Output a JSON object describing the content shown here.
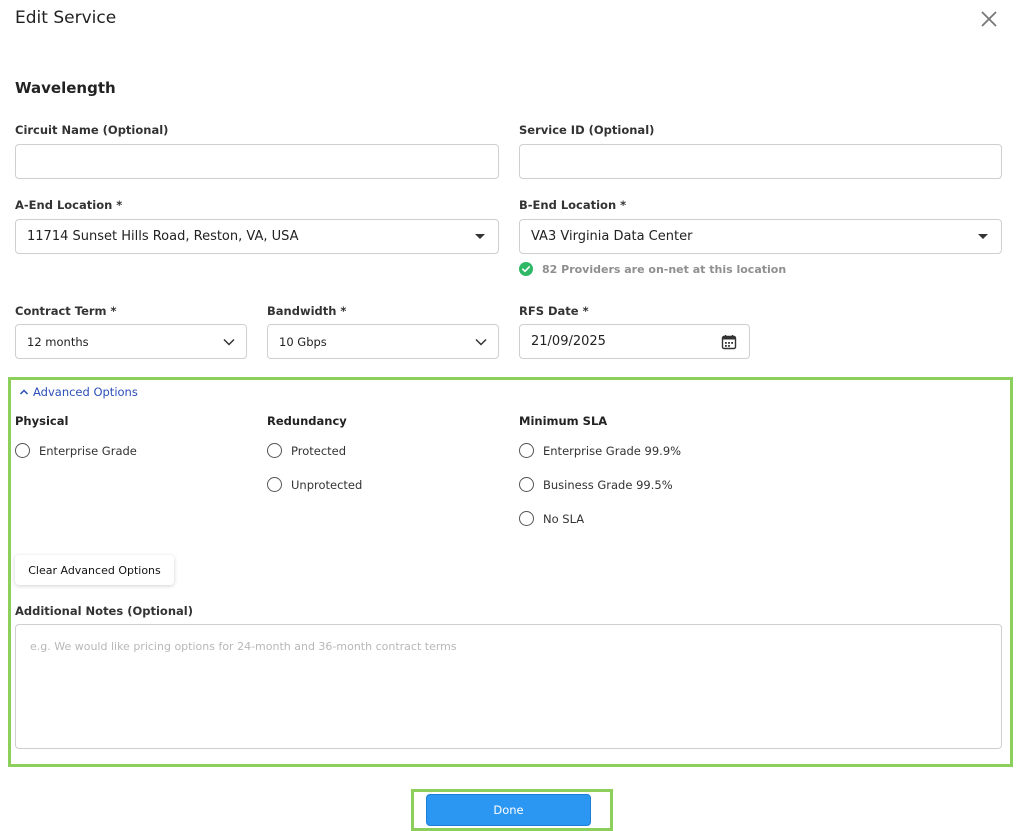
{
  "dialog": {
    "title": "Edit Service",
    "close_icon": "close-icon"
  },
  "section": {
    "title": "Wavelength"
  },
  "fields": {
    "circuit_name": {
      "label": "Circuit Name (Optional)",
      "value": ""
    },
    "service_id": {
      "label": "Service ID (Optional)",
      "value": ""
    },
    "a_end": {
      "label": "A-End Location *",
      "value": "11714 Sunset Hills Road, Reston, VA, USA"
    },
    "b_end": {
      "label": "B-End Location *",
      "value": "VA3 Virginia Data Center",
      "status": "82 Providers are on-net at this location"
    },
    "contract_term": {
      "label": "Contract Term *",
      "value": "12 months"
    },
    "bandwidth": {
      "label": "Bandwidth *",
      "value": "10 Gbps"
    },
    "rfs_date": {
      "label": "RFS Date *",
      "value": "21/09/2025"
    }
  },
  "advanced": {
    "toggle_label": "Advanced Options",
    "physical": {
      "title": "Physical",
      "options": [
        "Enterprise Grade"
      ]
    },
    "redundancy": {
      "title": "Redundancy",
      "options": [
        "Protected",
        "Unprotected"
      ]
    },
    "minimum_sla": {
      "title": "Minimum SLA",
      "options": [
        "Enterprise Grade 99.9%",
        "Business Grade 99.5%",
        "No SLA"
      ]
    },
    "clear_label": "Clear Advanced Options",
    "notes": {
      "label": "Additional Notes (Optional)",
      "placeholder": "e.g. We would like pricing options for 24-month and 36-month contract terms"
    }
  },
  "footer": {
    "done_label": "Done"
  },
  "colors": {
    "accent": "#2c97f2",
    "highlight": "#8ccf5a",
    "success": "#2fb866",
    "link": "#2b4fb8"
  }
}
